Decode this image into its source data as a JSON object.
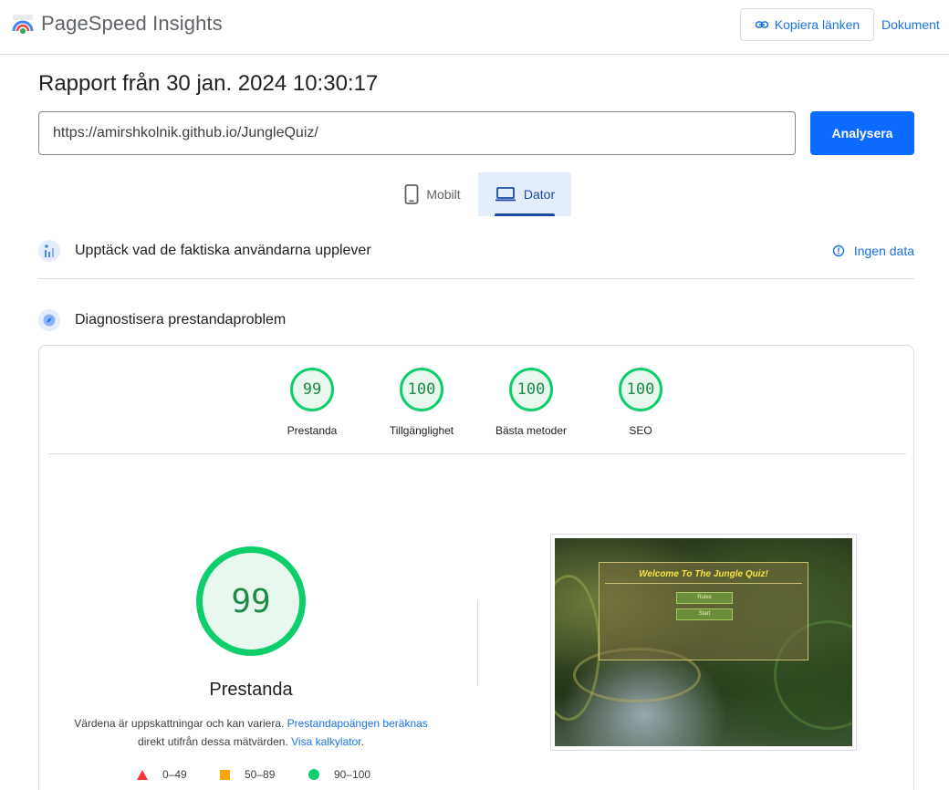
{
  "header": {
    "app_title": "PageSpeed Insights",
    "copy_link_label": "Kopiera länken",
    "docs_label": "Dokument"
  },
  "report": {
    "title": "Rapport från 30 jan. 2024 10:30:17"
  },
  "url_bar": {
    "value": "https://amirshkolnik.github.io/JungleQuiz/",
    "analyze_label": "Analysera"
  },
  "tabs": [
    {
      "label": "Mobilt",
      "icon": "phone-icon",
      "selected": false
    },
    {
      "label": "Dator",
      "icon": "laptop-icon",
      "selected": true
    }
  ],
  "field_data": {
    "title": "Upptäck vad de faktiska användarna upplever",
    "status": "Ingen data"
  },
  "diagnose": {
    "title": "Diagnostisera prestandaproblem"
  },
  "scores": [
    {
      "label": "Prestanda",
      "value": "99"
    },
    {
      "label": "Tillgänglighet",
      "value": "100"
    },
    {
      "label": "Bästa metoder",
      "value": "100"
    },
    {
      "label": "SEO",
      "value": "100"
    }
  ],
  "performance": {
    "score": "99",
    "label": "Prestanda",
    "note_text": "Värdena är uppskattningar och kan variera. ",
    "note_link1": "Prestandapoängen beräknas",
    "note_text2": " direkt utifrån dessa mätvärden. ",
    "note_link2": "Visa kalkylator",
    "note_end": "."
  },
  "legend": [
    {
      "range": "0–49",
      "color": "#ff3333",
      "shape": "triangle"
    },
    {
      "range": "50–89",
      "color": "#ffa400",
      "shape": "square"
    },
    {
      "range": "90–100",
      "color": "#0cce6b",
      "shape": "circle"
    }
  ],
  "screenshot": {
    "heading": "Welcome To The Jungle Quiz!",
    "buttons": [
      "Rules",
      "Start"
    ]
  },
  "colors": {
    "accent": "#1a73e8",
    "primary_button": "#0b6bff",
    "good_score": "#0cce6b"
  }
}
